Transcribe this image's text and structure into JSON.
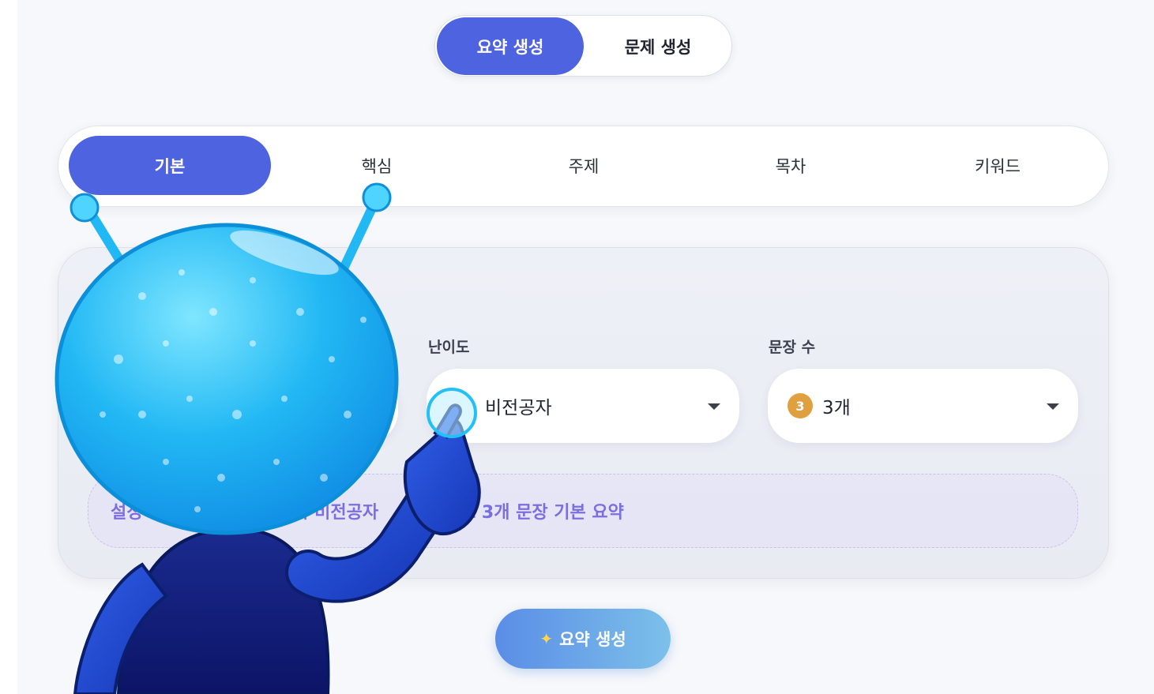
{
  "mode_toggle": {
    "summary_label": "요약 생성",
    "question_label": "문제 생성",
    "active": "summary"
  },
  "tabs": [
    {
      "label": "기본",
      "active": true
    },
    {
      "label": "핵심",
      "active": false
    },
    {
      "label": "주제",
      "active": false
    },
    {
      "label": "목차",
      "active": false
    },
    {
      "label": "키워드",
      "active": false
    }
  ],
  "settings": {
    "difficulty": {
      "label": "난이도",
      "value": "비전공자"
    },
    "sentence_count": {
      "label": "문장 수",
      "value": "3개",
      "badge": "3"
    }
  },
  "summary_preview": {
    "fragment_1": "설정",
    "fragment_2": "야의 비전공자",
    "fragment_3": "로 3개 문장 기본 요약"
  },
  "generate_button": {
    "label": "요약 생성",
    "icon": "sparkles-icon"
  },
  "colors": {
    "accent": "#4d63e0",
    "summary_text": "#7b6fe0",
    "badge": "#e0a040"
  }
}
